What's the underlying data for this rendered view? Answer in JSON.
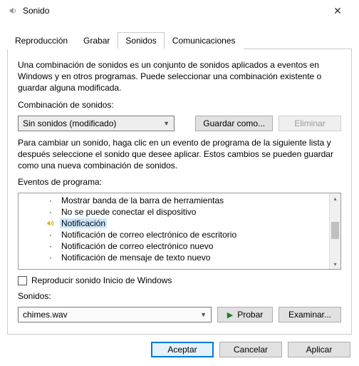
{
  "window": {
    "title": "Sonido"
  },
  "tabs": {
    "items": [
      {
        "label": "Reproducción"
      },
      {
        "label": "Grabar"
      },
      {
        "label": "Sonidos"
      },
      {
        "label": "Comunicaciones"
      }
    ],
    "active_index": 2
  },
  "scheme": {
    "description": "Una combinación de sonidos es un conjunto de sonidos aplicados a eventos en Windows y en otros programas. Puede seleccionar una combinación existente o guardar alguna modificada.",
    "label": "Combinación de sonidos:",
    "selected": "Sin sonidos (modificado)",
    "save_as": "Guardar como...",
    "delete": "Eliminar"
  },
  "events": {
    "instructions": "Para cambiar un sonido, haga clic en un evento de programa de la siguiente lista y después seleccione el sonido que desee aplicar. Estos cambios se pueden guardar como una nueva combinación de sonidos.",
    "label": "Eventos de programa:",
    "items": [
      {
        "text": "Mostrar banda de la barra de herramientas",
        "has_sound": false,
        "selected": false
      },
      {
        "text": "No se puede conectar el dispositivo",
        "has_sound": false,
        "selected": false
      },
      {
        "text": "Notificación",
        "has_sound": true,
        "selected": true
      },
      {
        "text": "Notificación de correo electrónico de escritorio",
        "has_sound": false,
        "selected": false
      },
      {
        "text": "Notificación de correo electrónico nuevo",
        "has_sound": false,
        "selected": false
      },
      {
        "text": "Notificación de mensaje de texto nuevo",
        "has_sound": false,
        "selected": false
      }
    ]
  },
  "startup": {
    "label": "Reproducir sonido Inicio de Windows",
    "checked": false
  },
  "sound": {
    "label": "Sonidos:",
    "selected": "chimes.wav",
    "play": "Probar",
    "browse": "Examinar..."
  },
  "footer": {
    "ok": "Aceptar",
    "cancel": "Cancelar",
    "apply": "Aplicar"
  }
}
